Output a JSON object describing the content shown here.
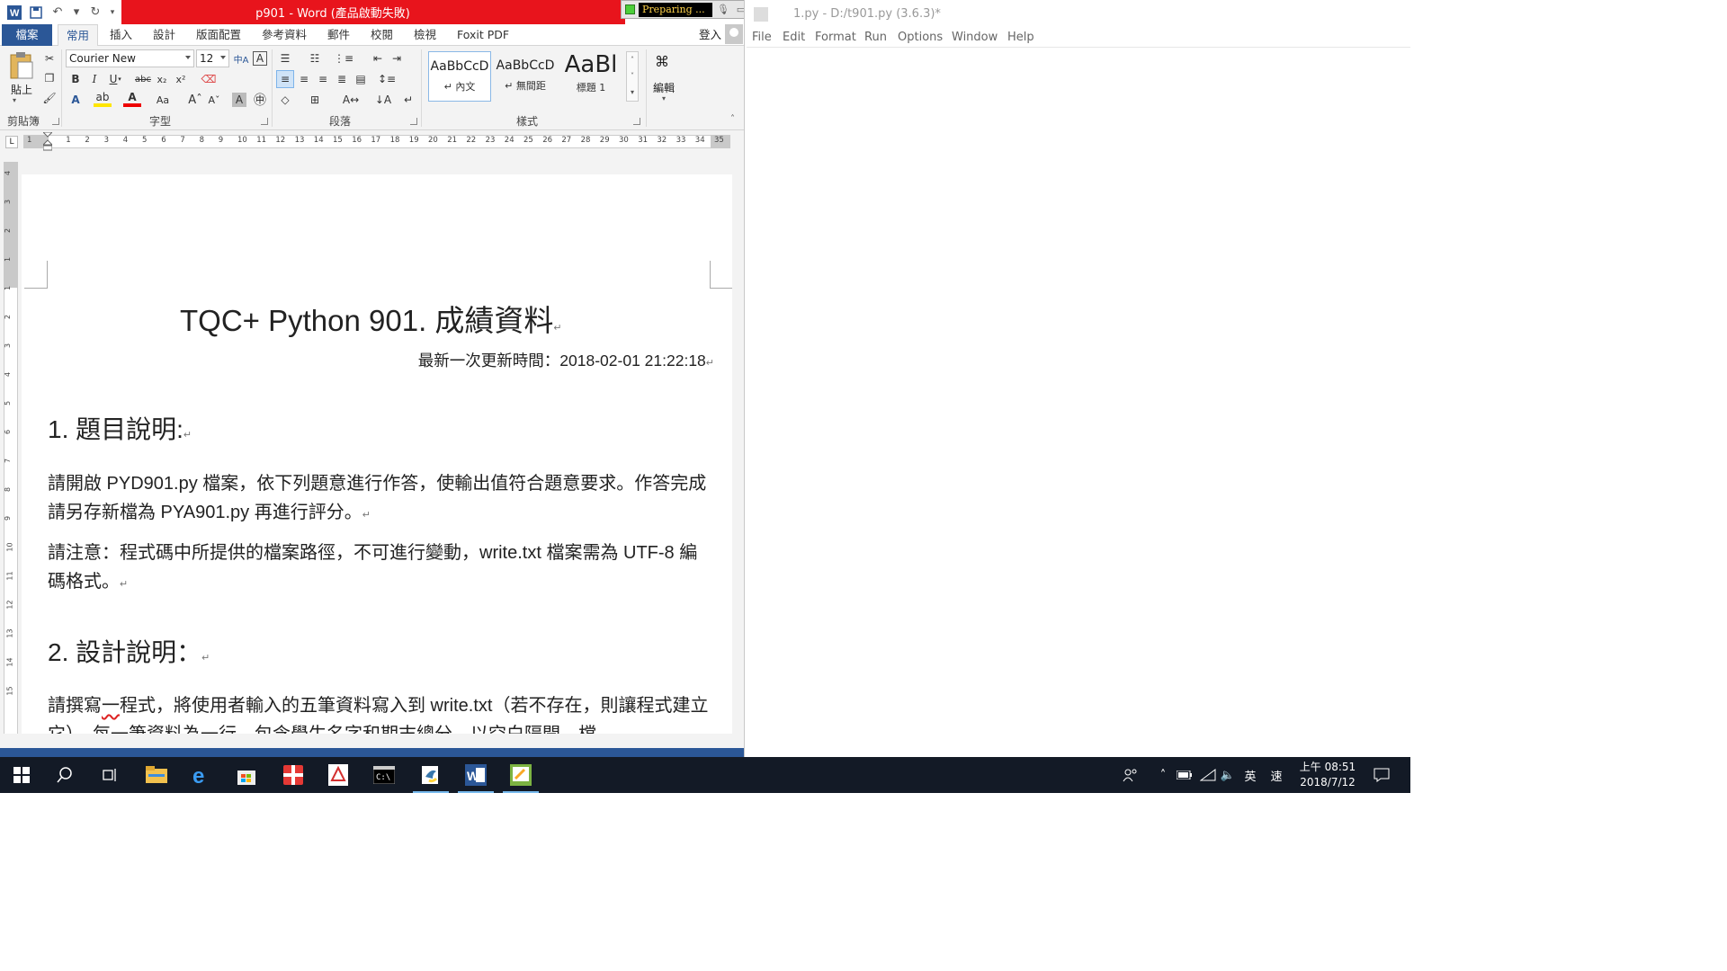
{
  "word": {
    "window_title": "p901 - Word (產品啟動失敗)",
    "recorder": {
      "status_text": "Preparing ..."
    },
    "tabs": [
      "檔案",
      "常用",
      "插入",
      "設計",
      "版面配置",
      "參考資料",
      "郵件",
      "校閱",
      "檢視",
      "Foxit PDF"
    ],
    "signin": "登入",
    "ribbon": {
      "paste_label": "貼上",
      "font_name": "Courier New",
      "font_size": "12",
      "groups": [
        "剪貼簿",
        "字型",
        "段落",
        "樣式",
        "編輯"
      ],
      "styles": [
        {
          "preview": "AaBbCcD",
          "name": "↵ 內文"
        },
        {
          "preview": "AaBbCcD",
          "name": "↵ 無間距"
        },
        {
          "preview": "AaBl",
          "name": "標題 1"
        }
      ],
      "edit_label": "編輯"
    },
    "ruler_ticks": [
      "1",
      "1",
      "2",
      "3",
      "4",
      "5",
      "6",
      "7",
      "8",
      "9",
      "10",
      "11",
      "12",
      "13",
      "14",
      "15",
      "16",
      "17",
      "18",
      "19",
      "20",
      "21",
      "22",
      "23",
      "24",
      "25",
      "26",
      "27",
      "28",
      "29",
      "30",
      "31",
      "32",
      "33",
      "34",
      "35"
    ],
    "vruler_ticks": [
      "4",
      "3",
      "2",
      "1",
      "1",
      "2",
      "3",
      "4",
      "5",
      "6",
      "7",
      "8",
      "9",
      "10",
      "11",
      "12",
      "13",
      "14",
      "15"
    ],
    "document": {
      "title": "TQC+ Python 901.  成績資料",
      "updated": "最新一次更新時間：2018-02-01 21:22:18",
      "h1": "1.  題目說明:",
      "p1": "請開啟 PYD901.py 檔案，依下列題意進行作答，使輸出值符合題意要求。作答完成請另存新檔為 PYA901.py 再進行評分。",
      "p2": "請注意：程式碼中所提供的檔案路徑，不可進行變動，write.txt 檔案需為 UTF-8 編碼格式。",
      "h2": "2.  設計說明：",
      "p3_pre": "請撰寫",
      "p3_squiggle": "一",
      "p3_post": "程式，將使用者輸入的五筆資料寫入到 write.txt（若不存在，則讓程式建立它），每一筆資料為一行，包含學生名字和期末總分，以空白隔開。檔"
    }
  },
  "idle": {
    "title": "1.py - D:/t901.py (3.6.3)*",
    "menu": [
      "File",
      "Edit",
      "Format",
      "Run",
      "Options",
      "Window",
      "Help"
    ]
  },
  "taskbar": {
    "tray_ime": "英",
    "tray_ime2": "速",
    "time": "上午 08:51",
    "date": "2018/7/12"
  },
  "colors": {
    "word_blue": "#2b5797",
    "title_red": "#e8141c",
    "taskbar_bg": "#131a26"
  }
}
